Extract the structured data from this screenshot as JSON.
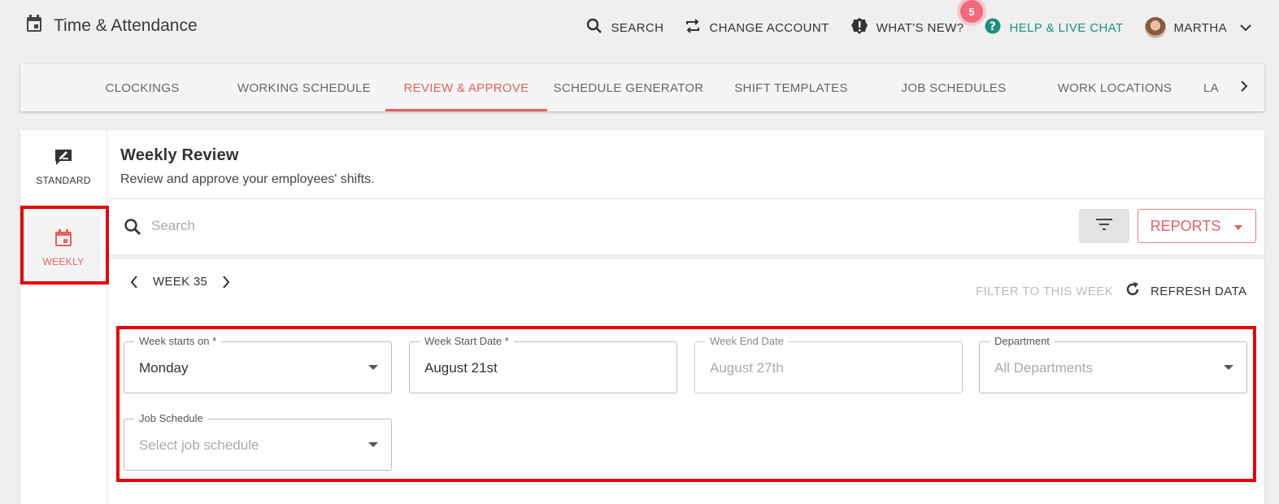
{
  "app": {
    "title": "Time & Attendance"
  },
  "topbar": {
    "search": "SEARCH",
    "change_account": "CHANGE ACCOUNT",
    "whats_new": "WHAT'S NEW?",
    "whats_new_badge": "5",
    "help": "HELP & LIVE CHAT",
    "user": "MARTHA"
  },
  "tabs": [
    {
      "label": "CLOCKINGS"
    },
    {
      "label": "WORKING SCHEDULE"
    },
    {
      "label": "REVIEW & APPROVE"
    },
    {
      "label": "SCHEDULE GENERATOR"
    },
    {
      "label": "SHIFT TEMPLATES"
    },
    {
      "label": "JOB SCHEDULES"
    },
    {
      "label": "WORK LOCATIONS"
    },
    {
      "label": "LA"
    }
  ],
  "sidenav": {
    "standard": "STANDARD",
    "weekly": "WEEKLY"
  },
  "header": {
    "title": "Weekly Review",
    "subtitle": "Review and approve your employees' shifts."
  },
  "search": {
    "placeholder": "Search"
  },
  "reports": {
    "label": "REPORTS"
  },
  "week": {
    "label": "WEEK 35",
    "filter_label": "FILTER TO THIS WEEK",
    "refresh_label": "REFRESH DATA"
  },
  "form": {
    "week_starts_on": {
      "label": "Week starts on *",
      "value": "Monday"
    },
    "week_start_date": {
      "label": "Week Start Date *",
      "value": "August 21st"
    },
    "week_end_date": {
      "label": "Week End Date",
      "value": "August 27th"
    },
    "department": {
      "label": "Department",
      "value": "All Departments"
    },
    "job_schedule": {
      "label": "Job Schedule",
      "value": "Select job schedule"
    }
  },
  "colors": {
    "accent": "#e86060",
    "help": "#1e8f7e",
    "highlight": "#e8000a"
  }
}
